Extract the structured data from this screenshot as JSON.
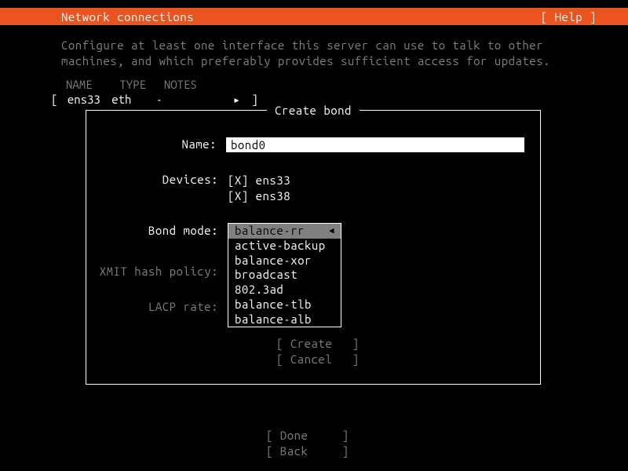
{
  "header": {
    "title": "Network connections",
    "help": "[ Help ]"
  },
  "description": "Configure at least one interface this server can use to talk to other machines, and which preferably provides sufficient access for updates.",
  "iface_table": {
    "headers": {
      "name": "NAME",
      "type": "TYPE",
      "notes": "NOTES"
    },
    "row": {
      "bracket_open": "[",
      "name": "ens33",
      "type": "eth",
      "notes": "-",
      "arrow": "▸",
      "bracket_close": "]"
    }
  },
  "dialog": {
    "title": "Create bond",
    "name_label": "Name:",
    "name_value": "bond0",
    "devices_label": "Devices:",
    "devices": [
      {
        "checked": "[X]",
        "name": "ens33"
      },
      {
        "checked": "[X]",
        "name": "ens38"
      }
    ],
    "bond_mode_label": "Bond mode:",
    "bond_mode_options": [
      "balance-rr",
      "active-backup",
      "balance-xor",
      "broadcast",
      "802.3ad",
      "balance-tlb",
      "balance-alb"
    ],
    "bond_mode_selected_index": 0,
    "xmit_label": "XMIT hash policy:",
    "lacp_label": "LACP rate:",
    "buttons": {
      "create": "Create",
      "cancel": "Cancel"
    }
  },
  "bottom": {
    "done": "Done",
    "back": "Back"
  }
}
